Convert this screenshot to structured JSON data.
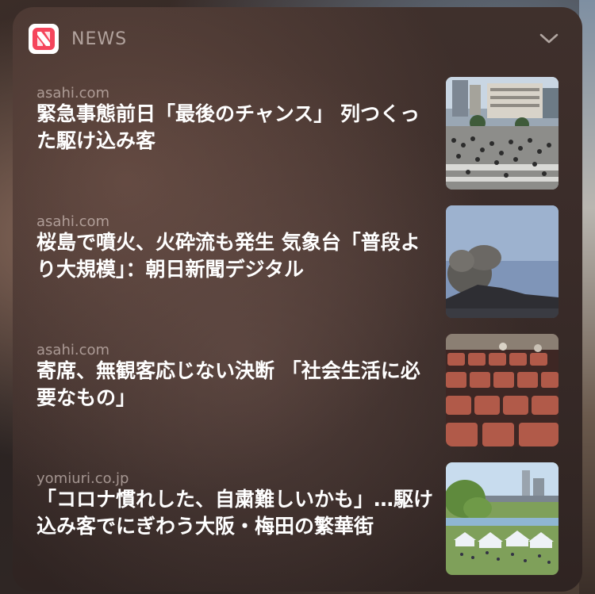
{
  "widget": {
    "app_name": "NEWS",
    "app_icon": "apple-news-icon",
    "collapse_icon": "chevron-down-icon"
  },
  "items": [
    {
      "source": "asahi.com",
      "title": "緊急事態前日「最後のチャンス」 列つくった駆け込み客",
      "thumbnail": "crowd-crossing-photo"
    },
    {
      "source": "asahi.com",
      "title": "桜島で噴火、火砕流も発生 気象台「普段より大規模」：朝日新聞デジタル",
      "thumbnail": "volcano-eruption-photo"
    },
    {
      "source": "asahi.com",
      "title": "寄席、無観客応じない決断 「社会生活に必要なもの」",
      "thumbnail": "theater-seats-photo"
    },
    {
      "source": "yomiuri.co.jp",
      "title": "「コロナ慣れした、自粛難しいかも」…駆け込み客でにぎわう大阪・梅田の繁華街",
      "thumbnail": "riverside-tents-photo"
    }
  ],
  "colors": {
    "brand": "#f5455c",
    "title": "#ffffff",
    "secondary": "#b8a9a4"
  }
}
